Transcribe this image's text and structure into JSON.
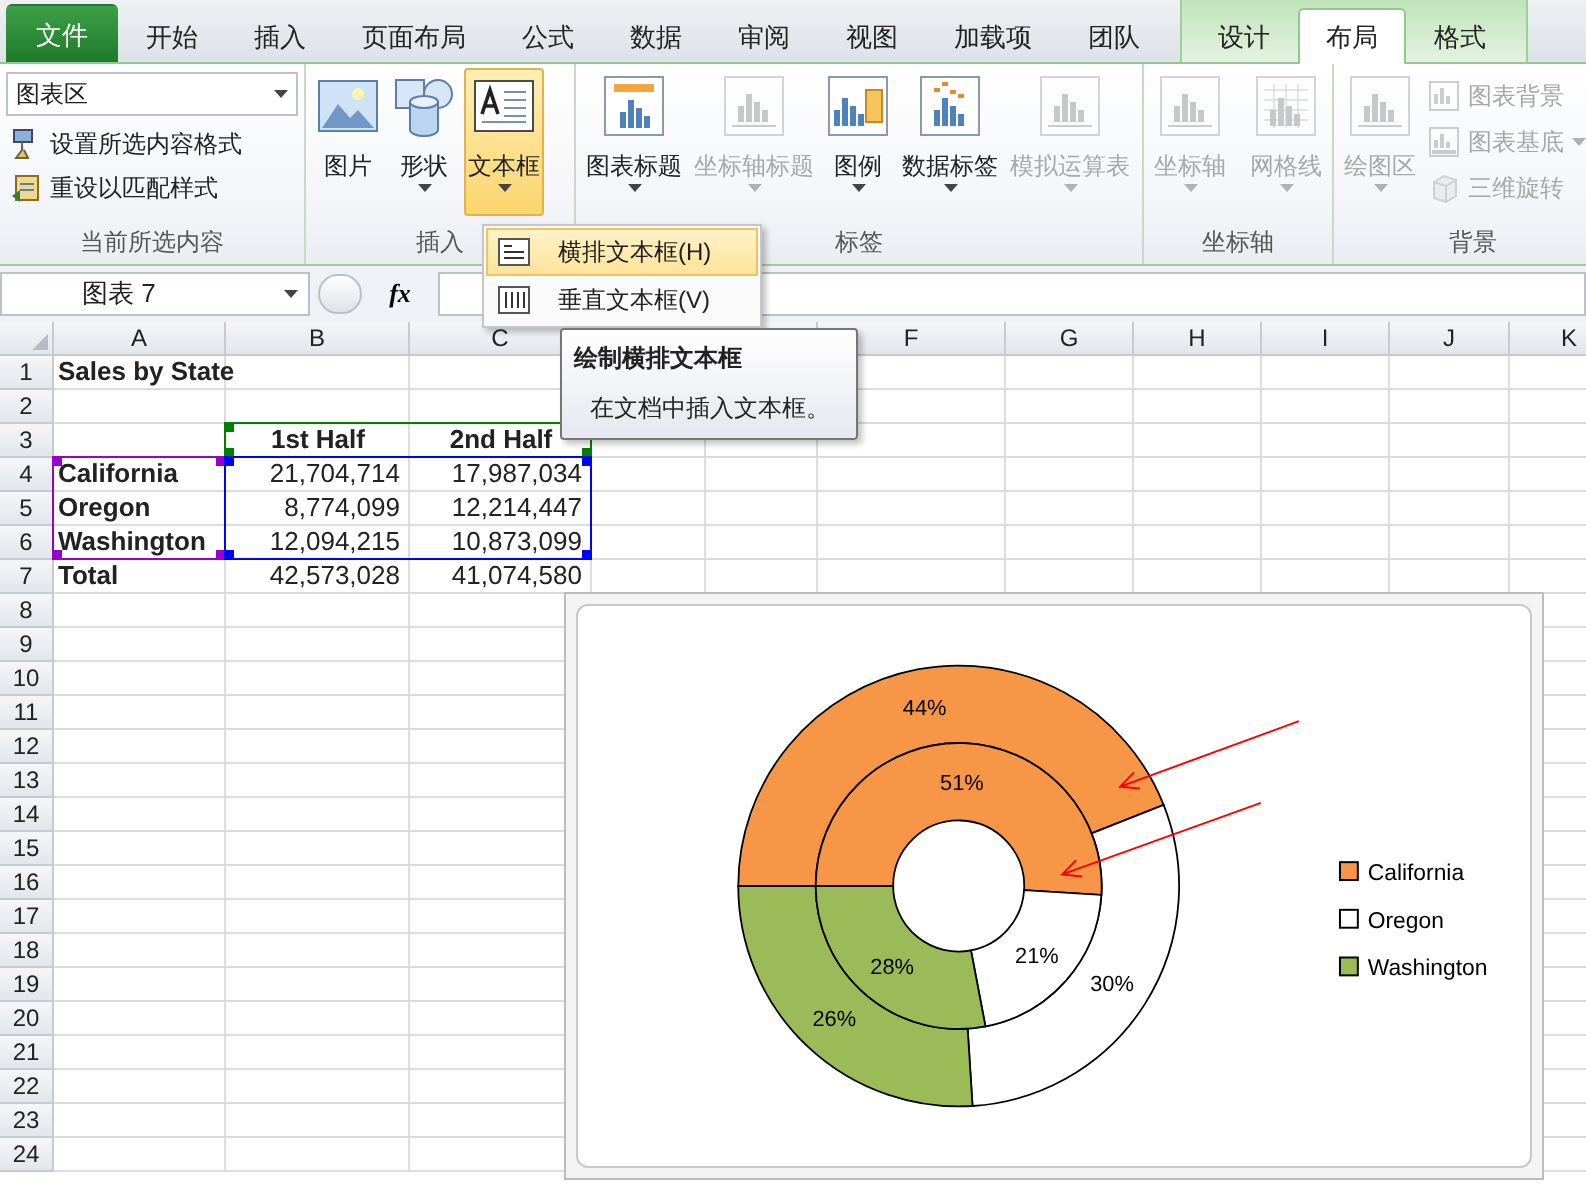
{
  "ribbon_tabs": [
    {
      "label": "文件",
      "kind": "file",
      "selected": false
    },
    {
      "label": "开始",
      "kind": "normal",
      "selected": false
    },
    {
      "label": "插入",
      "kind": "normal",
      "selected": false
    },
    {
      "label": "页面布局",
      "kind": "normal",
      "selected": false
    },
    {
      "label": "公式",
      "kind": "normal",
      "selected": false
    },
    {
      "label": "数据",
      "kind": "normal",
      "selected": false
    },
    {
      "label": "审阅",
      "kind": "normal",
      "selected": false
    },
    {
      "label": "视图",
      "kind": "normal",
      "selected": false
    },
    {
      "label": "加载项",
      "kind": "normal",
      "selected": false
    },
    {
      "label": "团队",
      "kind": "normal",
      "selected": false
    },
    {
      "label": "设计",
      "kind": "contextual",
      "selected": false
    },
    {
      "label": "布局",
      "kind": "contextual",
      "selected": true
    },
    {
      "label": "格式",
      "kind": "contextual",
      "selected": false
    }
  ],
  "ribbon_groups": [
    {
      "label": "当前所选内容",
      "kind": "selection",
      "dropdown": "图表区",
      "commands": [
        {
          "label": "设置所选内容格式",
          "disabled": false,
          "menu": false
        },
        {
          "label": "重设以匹配样式",
          "disabled": false,
          "menu": false
        }
      ]
    },
    {
      "label": "插入",
      "kind": "large",
      "buttons": [
        {
          "label": "图片",
          "disabled": false,
          "menu": false,
          "pressed": false
        },
        {
          "label": "形状",
          "disabled": false,
          "menu": true,
          "pressed": false
        },
        {
          "label": "文本框",
          "disabled": false,
          "menu": true,
          "pressed": true
        }
      ]
    },
    {
      "label": "标签",
      "kind": "large",
      "buttons": [
        {
          "label": "图表标题",
          "disabled": false,
          "menu": true,
          "pressed": false
        },
        {
          "label": "坐标轴标题",
          "disabled": true,
          "menu": true,
          "pressed": false
        },
        {
          "label": "图例",
          "disabled": false,
          "menu": true,
          "pressed": false
        },
        {
          "label": "数据标签",
          "disabled": false,
          "menu": true,
          "pressed": false
        },
        {
          "label": "模拟运算表",
          "disabled": true,
          "menu": true,
          "pressed": false
        }
      ]
    },
    {
      "label": "坐标轴",
      "kind": "large",
      "buttons": [
        {
          "label": "坐标轴",
          "disabled": true,
          "menu": true,
          "pressed": false
        },
        {
          "label": "网格线",
          "disabled": true,
          "menu": true,
          "pressed": false
        }
      ]
    },
    {
      "label": "背景",
      "kind": "large",
      "buttons": [
        {
          "label": "绘图区",
          "disabled": true,
          "menu": true,
          "pressed": false
        }
      ],
      "commands": [
        {
          "label": "图表背景",
          "disabled": true,
          "menu": false
        },
        {
          "label": "图表基底",
          "disabled": true,
          "menu": true
        },
        {
          "label": "三维旋转",
          "disabled": true,
          "menu": false
        }
      ]
    }
  ],
  "name_box": {
    "value": "图表 7"
  },
  "formula_bar": {
    "fx_label": "fx"
  },
  "textbox_menu": [
    {
      "label": "横排文本框(H)",
      "selected": true
    },
    {
      "label": "垂直文本框(V)",
      "selected": false
    }
  ],
  "tooltip": {
    "title": "绘制横排文本框",
    "text": "在文档中插入文本框。"
  },
  "sheet": {
    "columns": [
      "A",
      "B",
      "C",
      null,
      null,
      "F",
      "G",
      "H",
      "I",
      "J",
      "K"
    ],
    "rows": [
      {
        "label": "1",
        "cells": [
          {
            "text": "Sales by State",
            "kind": "title"
          }
        ]
      },
      {
        "label": "2"
      },
      {
        "label": "3",
        "cells": [
          null,
          {
            "text": "1st Half",
            "kind": "header",
            "color": "#008000"
          },
          {
            "text": "2nd Half",
            "kind": "header",
            "color": "#008000"
          }
        ]
      },
      {
        "label": "4",
        "cells": [
          {
            "text": "California",
            "kind": "label",
            "color": "#9900cc"
          },
          {
            "text": "21,704,714",
            "kind": "number",
            "color": "#0000ff"
          },
          {
            "text": "17,987,034",
            "kind": "number",
            "color": "#0000ff"
          }
        ]
      },
      {
        "label": "5",
        "cells": [
          {
            "text": "Oregon",
            "kind": "label",
            "color": "#9900cc"
          },
          {
            "text": "8,774,099",
            "kind": "number",
            "color": "#0000ff"
          },
          {
            "text": "12,214,447",
            "kind": "number",
            "color": "#0000ff"
          }
        ]
      },
      {
        "label": "6",
        "cells": [
          {
            "text": "Washington",
            "kind": "label",
            "color": "#9900cc"
          },
          {
            "text": "12,094,215",
            "kind": "number",
            "color": "#0000ff"
          },
          {
            "text": "10,873,099",
            "kind": "number",
            "color": "#0000ff"
          }
        ]
      },
      {
        "label": "7",
        "cells": [
          {
            "text": "Total",
            "kind": "label"
          },
          {
            "text": "42,573,028",
            "kind": "number"
          },
          {
            "text": "41,074,580",
            "kind": "number"
          }
        ]
      },
      {
        "label": "8"
      },
      {
        "label": "9"
      },
      {
        "label": "10"
      },
      {
        "label": "11"
      },
      {
        "label": "12"
      },
      {
        "label": "13"
      },
      {
        "label": "14"
      },
      {
        "label": "15"
      },
      {
        "label": "16"
      },
      {
        "label": "17"
      },
      {
        "label": "18"
      },
      {
        "label": "19"
      },
      {
        "label": "20"
      },
      {
        "label": "21"
      },
      {
        "label": "22"
      },
      {
        "label": "23"
      },
      {
        "label": "24"
      }
    ]
  },
  "chart": {
    "chart_data": {
      "type": "donut",
      "categories": [
        "California",
        "Oregon",
        "Washington"
      ],
      "colors": [
        "#f79646",
        "#ffffff",
        "#9bbb59"
      ],
      "series": [
        {
          "values": [
            44,
            30,
            26
          ],
          "value_labels": [
            "44%",
            "30%",
            "26%"
          ]
        },
        {
          "values": [
            51,
            21,
            28
          ],
          "value_labels": [
            "51%",
            "21%",
            "28%"
          ]
        }
      ],
      "data_labels": true,
      "legend": true
    },
    "overlays": [
      {
        "kind": "arrow"
      },
      {
        "kind": "arrow"
      }
    ]
  }
}
